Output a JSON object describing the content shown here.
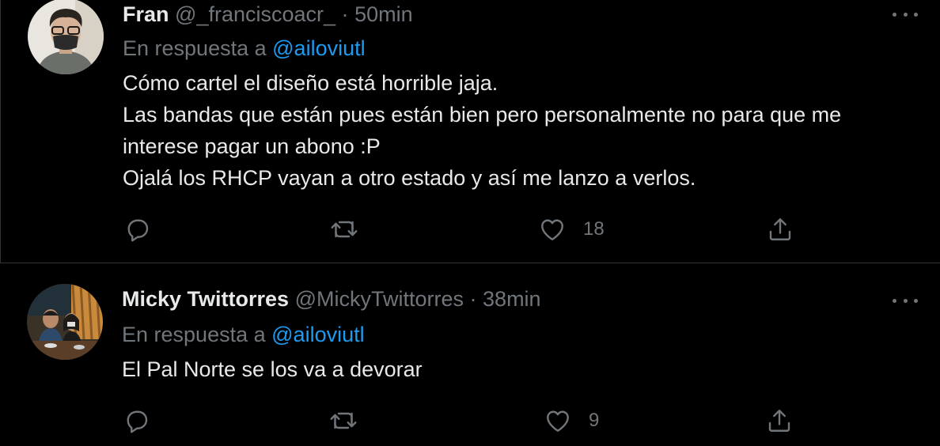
{
  "tweets": [
    {
      "name": "Fran",
      "handle": "@_franciscoacr_",
      "separator": "·",
      "time": "50min",
      "reply_prefix": "En respuesta a",
      "reply_to": "@ailoviutl",
      "text_lines": [
        "Cómo cartel el diseño está horrible jaja.",
        "Las bandas que están pues están bien pero personalmente no para que me",
        "interese pagar un abono :P",
        "Ojalá los RHCP vayan a otro estado y así me lanzo a verlos."
      ],
      "likes": "18",
      "icons": {
        "reply": "reply-icon",
        "retweet": "retweet-icon",
        "like": "heart-icon",
        "share": "share-icon",
        "more": "more-icon"
      }
    },
    {
      "name": "Micky Twittorres",
      "handle": "@MickyTwittorres",
      "separator": "·",
      "time": "38min",
      "reply_prefix": "En respuesta a",
      "reply_to": "@ailoviutl",
      "text_lines": [
        "El Pal Norte se los va a devorar"
      ],
      "likes": "9",
      "icons": {
        "reply": "reply-icon",
        "retweet": "retweet-icon",
        "like": "heart-icon",
        "share": "share-icon",
        "more": "more-icon"
      }
    }
  ],
  "colors": {
    "background": "#000000",
    "text": "#e7e9ea",
    "muted": "#71767b",
    "link": "#1d9bf0",
    "border": "#2f3336"
  }
}
